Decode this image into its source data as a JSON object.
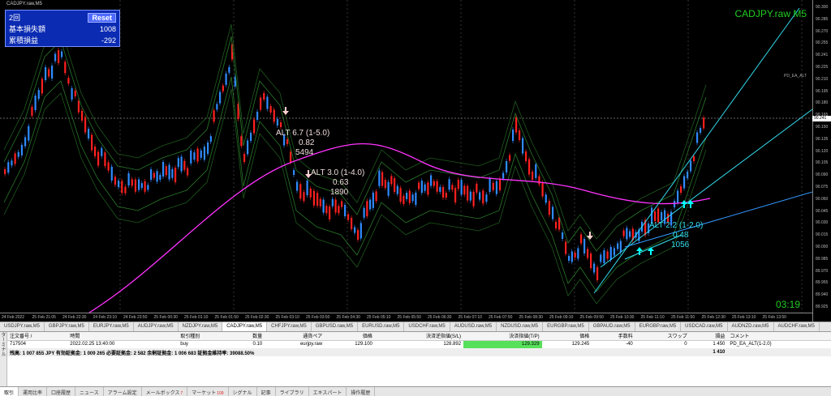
{
  "window": {
    "title": "CADJPY.raw,M5"
  },
  "chart": {
    "symbol_label": "CADJPY.raw M5",
    "ea_label": "PD_EA_ALT",
    "clock": "03:19",
    "current_price": "90.241",
    "info_panel": {
      "count": "2回",
      "reset": "Reset",
      "row2_label": "基本損失額",
      "row2_value": "1008",
      "row3_label": "累積損益",
      "row3_value": "-292"
    },
    "annotations": [
      {
        "text": [
          "ALT 6.7 (1-5.0)",
          "0.82",
          "5494"
        ],
        "color": "#f0dcdc"
      },
      {
        "text": [
          "ALT 3.0 (1-4.0)",
          "0.63",
          "1890"
        ],
        "color": "#f0dcdc"
      },
      {
        "text": [
          "ALT 2.2 (1-2.0)",
          "0.48",
          "1056"
        ],
        "color": "#33ddee"
      }
    ],
    "price_ticks": [
      "90.300",
      "90.285",
      "90.270",
      "90.255",
      "90.241",
      "90.225",
      "90.210",
      "90.195",
      "90.180",
      "90.165",
      "90.150",
      "90.135",
      "90.120",
      "90.105",
      "90.090",
      "90.075",
      "90.060",
      "90.045",
      "90.030",
      "90.015",
      "90.000",
      "89.985",
      "89.970",
      "89.955",
      "89.940",
      "89.925"
    ],
    "time_ticks": [
      "24 Feb 2022",
      "25 Feb 21:05",
      "24 Feb 22:30",
      "24 Feb 23:10",
      "24 Feb 23:50",
      "25 Feb 00:30",
      "25 Feb 01:10",
      "25 Feb 01:50",
      "25 Feb 02:30",
      "25 Feb 03:10",
      "25 Feb 03:50",
      "25 Feb 04:30",
      "25 Feb 05:10",
      "25 Feb 05:50",
      "25 Feb 06:30",
      "25 Feb 07:10",
      "25 Feb 07:50",
      "25 Feb 08:30",
      "25 Feb 09:10",
      "25 Feb 09:50",
      "25 Feb 10:30",
      "25 Feb 11:10",
      "25 Feb 11:50",
      "25 Feb 12:30",
      "25 Feb 13:10",
      "25 Feb 13:50"
    ]
  },
  "chart_tabs": [
    "USDJPY.raw,M5",
    "GBPJPY.raw,M5",
    "EURJPY.raw,M5",
    "AUDJPY.raw,M5",
    "NZDJPY.raw,M5",
    "CADJPY.raw,M5",
    "CHFJPY.raw,M5",
    "GBPUSD.raw,M5",
    "EURUSD.raw,M5",
    "USDCHF.raw,M5",
    "AUDUSD.raw,M5",
    "NZDUSD.raw,M5",
    "EURGBP.raw,M5",
    "GBPAUD.raw,M5",
    "EURGBP.raw,M5",
    "USDCAD.raw,M5",
    "AUDNZD.raw,M5",
    "AUDCHF.raw,M5"
  ],
  "terminal": {
    "side_label": "ターミナル",
    "headers": [
      "注文番号 /",
      "時間",
      "取引種別",
      "数量",
      "通貨ペア",
      "価格",
      "決済逆指値(S/L)",
      "決済指値(T/P)",
      "価格",
      "手数料",
      "スワップ",
      "損益",
      "コメント"
    ],
    "order": [
      "717504",
      "2022.02.25 13:40:00",
      "buy",
      "0.10",
      "eurjpy.raw",
      "129.100",
      "128.892",
      "129.329",
      "129.245",
      "-40",
      "0",
      "1 450",
      "PD_EA_ALT(1-2.0)"
    ],
    "balance_text": "残高: 1 007 855 JPY  有効証拠金: 1 009 265  必要証拠金: 2 582  余剰証拠金: 1 006 683  証拠金維持率: 39088.50%",
    "balance_profit": "1 410"
  },
  "bottom_tabs": [
    {
      "label": "取引",
      "badge": ""
    },
    {
      "label": "運用比率",
      "badge": ""
    },
    {
      "label": "口座履歴",
      "badge": ""
    },
    {
      "label": "ニュース",
      "badge": ""
    },
    {
      "label": "アラーム設定",
      "badge": ""
    },
    {
      "label": "メールボックス",
      "badge": "7"
    },
    {
      "label": "マーケット",
      "badge": "109"
    },
    {
      "label": "シグナル",
      "badge": ""
    },
    {
      "label": "記事",
      "badge": ""
    },
    {
      "label": "ライブラリ",
      "badge": ""
    },
    {
      "label": "エキスパート",
      "badge": ""
    },
    {
      "label": "操作履歴",
      "badge": ""
    }
  ],
  "colors": {
    "bull": "#2f8bff",
    "bear": "#ff2020",
    "ma": "#ff33ff",
    "band_inner": "#2a7a2a",
    "band_outer": "#1e5a1e",
    "trend": "#33ddee",
    "trend2": "#3399ff",
    "arrow_up": "#00ffff",
    "arrow_down": "#ffd0d0",
    "tp_bg": "#57e05a"
  }
}
